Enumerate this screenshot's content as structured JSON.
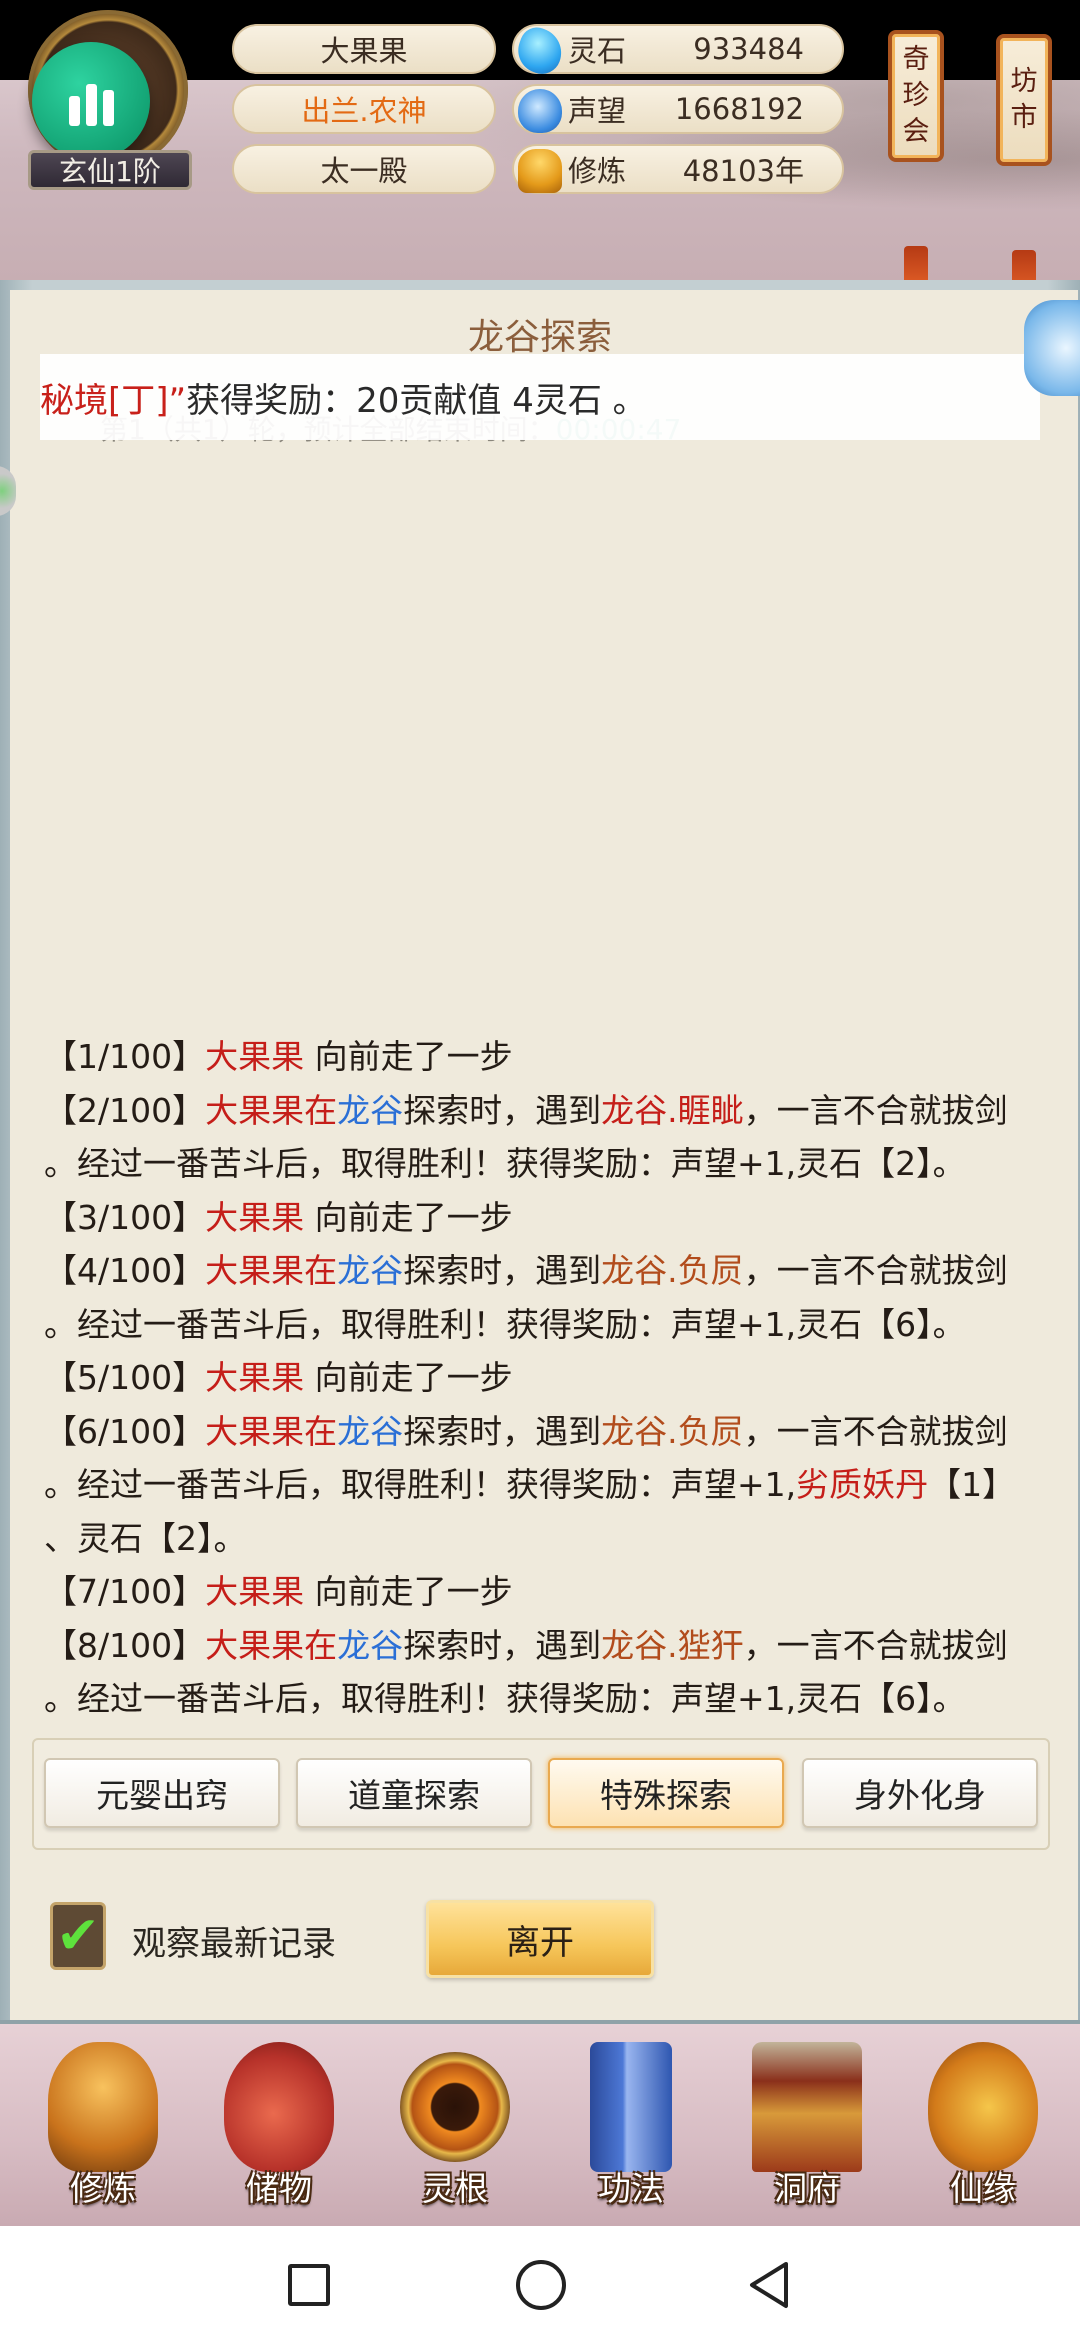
{
  "header": {
    "realm": "玄仙1阶",
    "names": [
      "大果果",
      "出兰.农神",
      "太一殿"
    ],
    "resources": [
      {
        "icon": "spirit-stone-icon",
        "label": "灵石",
        "value": "933484"
      },
      {
        "icon": "reputation-icon",
        "label": "声望",
        "value": "1668192"
      },
      {
        "icon": "cultivation-icon",
        "label": "修炼",
        "value": "48103年"
      }
    ],
    "signs": {
      "qizhenhui": [
        "奇",
        "珍",
        "会"
      ],
      "fangshi": [
        "坊",
        "市"
      ]
    }
  },
  "panel": {
    "title": "龙谷探索",
    "progress_prefix": "第1（共1）轮，预计全部结束时间：",
    "progress_time": "00:00:47",
    "reward_banner": {
      "part1": "秘境[丁]”",
      "part2": " 获得奖励：20贡献值 4灵石 。"
    }
  },
  "log": [
    {
      "segments": [
        {
          "t": "【1/100】"
        },
        {
          "t": "大果果",
          "c": "red"
        },
        {
          "t": " 向前走了一步"
        }
      ]
    },
    {
      "segments": [
        {
          "t": "【2/100】"
        },
        {
          "t": "大果果在",
          "c": "red"
        },
        {
          "t": "龙谷",
          "c": "blue"
        },
        {
          "t": "探索时，遇到"
        },
        {
          "t": "龙谷.睚眦",
          "c": "red"
        },
        {
          "t": "，一言不合就拔剑"
        }
      ]
    },
    {
      "segments": [
        {
          "t": "。经过一番苦斗后，取得胜利！获得奖励：声望+1,灵石【2】。"
        }
      ]
    },
    {
      "segments": [
        {
          "t": "【3/100】"
        },
        {
          "t": "大果果",
          "c": "red"
        },
        {
          "t": " 向前走了一步"
        }
      ]
    },
    {
      "segments": [
        {
          "t": "【4/100】"
        },
        {
          "t": "大果果在",
          "c": "red"
        },
        {
          "t": "龙谷",
          "c": "blue"
        },
        {
          "t": "探索时，遇到"
        },
        {
          "t": "龙谷.负屃",
          "c": "brown"
        },
        {
          "t": "，一言不合就拔剑"
        }
      ]
    },
    {
      "segments": [
        {
          "t": "。经过一番苦斗后，取得胜利！获得奖励：声望+1,灵石【6】。"
        }
      ]
    },
    {
      "segments": [
        {
          "t": "【5/100】"
        },
        {
          "t": "大果果",
          "c": "red"
        },
        {
          "t": " 向前走了一步"
        }
      ]
    },
    {
      "segments": [
        {
          "t": "【6/100】"
        },
        {
          "t": "大果果在",
          "c": "red"
        },
        {
          "t": "龙谷",
          "c": "blue"
        },
        {
          "t": "探索时，遇到"
        },
        {
          "t": "龙谷.负屃",
          "c": "brown"
        },
        {
          "t": "，一言不合就拔剑"
        }
      ]
    },
    {
      "segments": [
        {
          "t": "。经过一番苦斗后，取得胜利！获得奖励：声望+1,"
        },
        {
          "t": "劣质妖丹",
          "c": "red"
        },
        {
          "t": "【1】"
        }
      ]
    },
    {
      "segments": [
        {
          "t": "、灵石【2】。"
        }
      ]
    },
    {
      "segments": [
        {
          "t": "【7/100】"
        },
        {
          "t": "大果果",
          "c": "red"
        },
        {
          "t": " 向前走了一步"
        }
      ]
    },
    {
      "segments": [
        {
          "t": "【8/100】"
        },
        {
          "t": "大果果在",
          "c": "red"
        },
        {
          "t": "龙谷",
          "c": "blue"
        },
        {
          "t": "探索时，遇到"
        },
        {
          "t": "龙谷.狴犴",
          "c": "brown"
        },
        {
          "t": "，一言不合就拔剑"
        }
      ]
    },
    {
      "segments": [
        {
          "t": "。经过一番苦斗后，取得胜利！获得奖励：声望+1,灵石【6】。"
        }
      ]
    }
  ],
  "tabs": [
    "元婴出窍",
    "道童探索",
    "特殊探索",
    "身外化身"
  ],
  "active_tab": "特殊探索",
  "watch_latest": {
    "label": "观察最新记录",
    "checked": true
  },
  "leave_label": "离开",
  "bottom_nav": [
    {
      "label": "修炼",
      "icon": "meditating-monk-icon"
    },
    {
      "label": "储物",
      "icon": "storage-bag-icon"
    },
    {
      "label": "灵根",
      "icon": "spirit-root-icon"
    },
    {
      "label": "功法",
      "icon": "skill-book-icon"
    },
    {
      "label": "洞府",
      "icon": "cave-residence-icon"
    },
    {
      "label": "仙缘",
      "icon": "gourd-icon"
    }
  ],
  "colors": {
    "red": "#c51e19",
    "blue": "#2a6fd6",
    "brown": "#b24c1c",
    "accent_gold": "#f6c65a",
    "name_orange": "#e36a14"
  }
}
